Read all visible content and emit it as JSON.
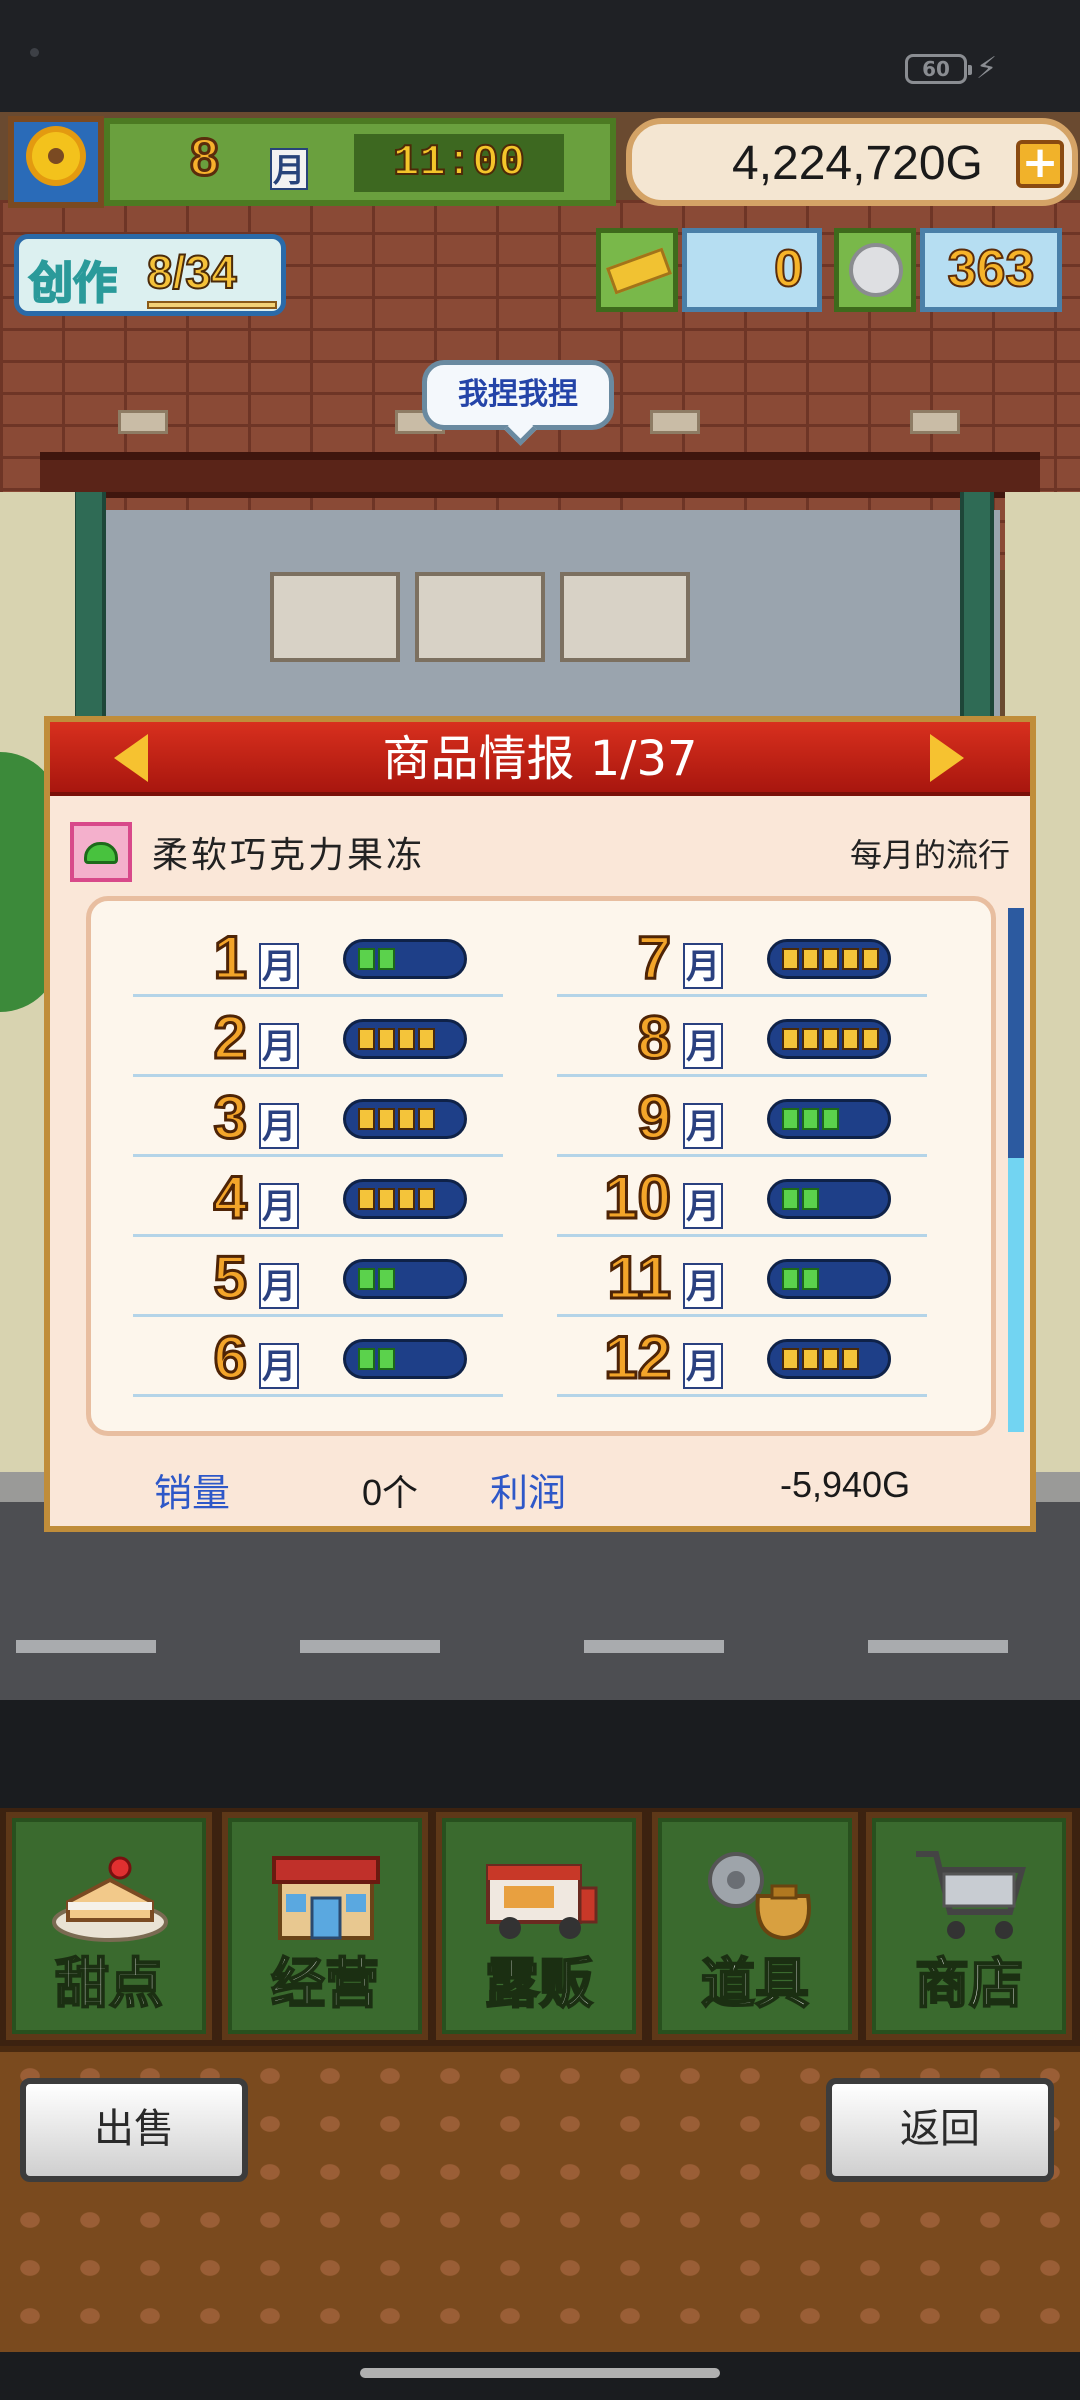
{
  "status_bar": {
    "battery": "60"
  },
  "hud": {
    "month": "8",
    "month_unit": "月",
    "time": "11:00",
    "money": "4,224,720G",
    "create_label": "创作",
    "create_count": "8/34",
    "gold_count": "0",
    "coin_count": "363"
  },
  "scene": {
    "speech": "我捏我捏"
  },
  "panel": {
    "title": "商品情报 1/37",
    "product_name": "柔软巧克力果冻",
    "trend_label": "每月的流行",
    "sales_label": "销量",
    "sales_value": "0个",
    "profit_label": "利润",
    "profit_value": "-5,940G",
    "months": [
      {
        "month": "1",
        "unit": "月",
        "level": 2,
        "color": "green"
      },
      {
        "month": "2",
        "unit": "月",
        "level": 4,
        "color": "yellow"
      },
      {
        "month": "3",
        "unit": "月",
        "level": 4,
        "color": "yellow"
      },
      {
        "month": "4",
        "unit": "月",
        "level": 4,
        "color": "yellow"
      },
      {
        "month": "5",
        "unit": "月",
        "level": 2,
        "color": "green"
      },
      {
        "month": "6",
        "unit": "月",
        "level": 2,
        "color": "green"
      },
      {
        "month": "7",
        "unit": "月",
        "level": 5,
        "color": "yellow"
      },
      {
        "month": "8",
        "unit": "月",
        "level": 5,
        "color": "yellow"
      },
      {
        "month": "9",
        "unit": "月",
        "level": 3,
        "color": "green"
      },
      {
        "month": "10",
        "unit": "月",
        "level": 2,
        "color": "green"
      },
      {
        "month": "11",
        "unit": "月",
        "level": 2,
        "color": "green"
      },
      {
        "month": "12",
        "unit": "月",
        "level": 4,
        "color": "yellow"
      }
    ]
  },
  "menu": [
    {
      "label": "甜点",
      "icon": "cake-icon"
    },
    {
      "label": "经营",
      "icon": "shop-building-icon"
    },
    {
      "label": "露贩",
      "icon": "food-truck-icon"
    },
    {
      "label": "道具",
      "icon": "items-bag-icon"
    },
    {
      "label": "商店",
      "icon": "shopping-cart-icon"
    }
  ],
  "footer": {
    "sell": "出售",
    "back": "返回"
  },
  "colors": {
    "header_red": "#c0221a",
    "panel_bg": "#fae7d8",
    "menu_green": "#3a6a2e",
    "gauge_blue": "#1e3f88"
  }
}
